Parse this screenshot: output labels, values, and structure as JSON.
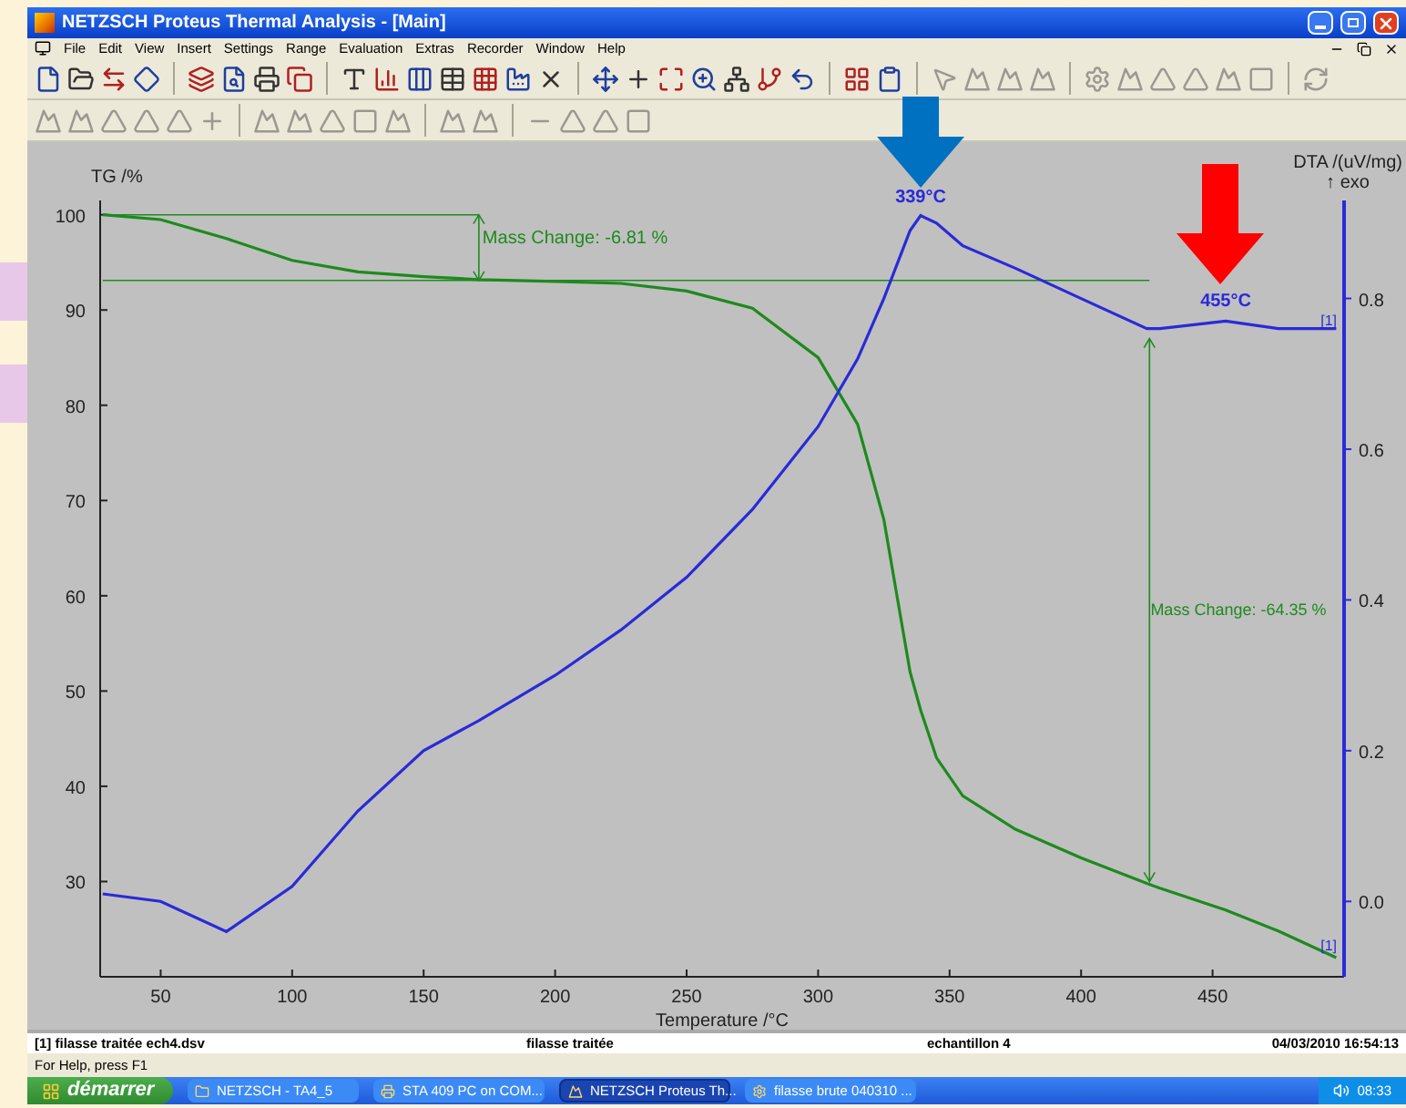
{
  "window": {
    "title": "NETZSCH Proteus Thermal Analysis - [Main]"
  },
  "menu": [
    "File",
    "Edit",
    "View",
    "Insert",
    "Settings",
    "Range",
    "Evaluation",
    "Extras",
    "Recorder",
    "Window",
    "Help"
  ],
  "chart": {
    "exo_note": "↑ exo",
    "chart_data": {
      "type": "line",
      "xlabel": "Temperature /°C",
      "ylabel": "TG /%",
      "xlim": [
        27,
        500
      ],
      "ylim": [
        20,
        101.5
      ],
      "xticks": [
        50,
        100,
        150,
        200,
        250,
        300,
        350,
        400,
        450
      ],
      "yticks": [
        30,
        40,
        50,
        60,
        70,
        80,
        90,
        100
      ],
      "x": [
        28,
        50,
        75,
        100,
        125,
        150,
        171,
        200,
        225,
        250,
        275,
        300,
        315,
        325,
        335,
        339,
        345,
        355,
        375,
        400,
        425,
        430,
        455,
        475,
        497
      ],
      "series": [
        {
          "color": "#1e8a1e",
          "values": [
            100,
            99.5,
            97.5,
            95.2,
            94,
            93.5,
            93.2,
            93,
            92.8,
            92,
            90.2,
            85,
            78,
            68,
            52,
            48,
            43,
            39,
            35.5,
            32.5,
            29.8,
            29.3,
            27,
            24.8,
            22
          ]
        }
      ],
      "ref_lines": [
        {
          "axis": "y",
          "value": 100
        },
        {
          "axis": "y",
          "value": 93.1
        },
        {
          "axis": "x",
          "value": 426
        }
      ],
      "annotations": [
        {
          "text": "Mass Change: -6.81 %"
        },
        {
          "text": "Mass Change: -64.35 %"
        },
        {
          "text": "[1]"
        }
      ]
    },
    "dta": {
      "chart_data": {
        "type": "line",
        "ylabel": "DTA /(uV/mg)",
        "xlim": [
          27,
          500
        ],
        "ylim": [
          -0.1,
          0.93
        ],
        "yticks": [
          {
            "value": 0,
            "label": "0.0"
          },
          0.2,
          0.4,
          0.6,
          0.8
        ],
        "x": [
          28,
          50,
          75,
          100,
          125,
          150,
          171,
          200,
          225,
          250,
          275,
          300,
          315,
          325,
          335,
          339,
          345,
          355,
          375,
          400,
          425,
          430,
          455,
          475,
          497
        ],
        "series": [
          {
            "color": "#2a2ad8",
            "values": [
              0.01,
              0,
              -0.04,
              0.02,
              0.12,
              0.2,
              0.24,
              0.3,
              0.36,
              0.43,
              0.52,
              0.63,
              0.72,
              0.8,
              0.89,
              0.91,
              0.9,
              0.87,
              0.84,
              0.8,
              0.76,
              0.76,
              0.77,
              0.76,
              0.76
            ]
          }
        ],
        "annotations": [
          {
            "text": "339°C"
          },
          {
            "text": "455°C"
          },
          {
            "text": "[1]"
          }
        ]
      }
    }
  },
  "highlight_arrows": [
    {
      "color": "#0070c0"
    },
    {
      "color": "#ff0000"
    }
  ],
  "info_bar": [
    "[1] filasse traitée ech4.dsv",
    "filasse traitée",
    "echantillon 4",
    "04/03/2010 16:54:13"
  ],
  "status_bar": "For Help, press F1",
  "taskbar": {
    "start": "démarrer",
    "tasks": [
      {
        "label": "NETZSCH - TA4_5",
        "selected": false
      },
      {
        "label": "STA 409 PC on  COM...",
        "selected": false
      },
      {
        "label": "NETZSCH Proteus Th...",
        "selected": true
      },
      {
        "label": "filasse brute 040310 ...",
        "selected": false
      }
    ],
    "clock": "08:33"
  }
}
